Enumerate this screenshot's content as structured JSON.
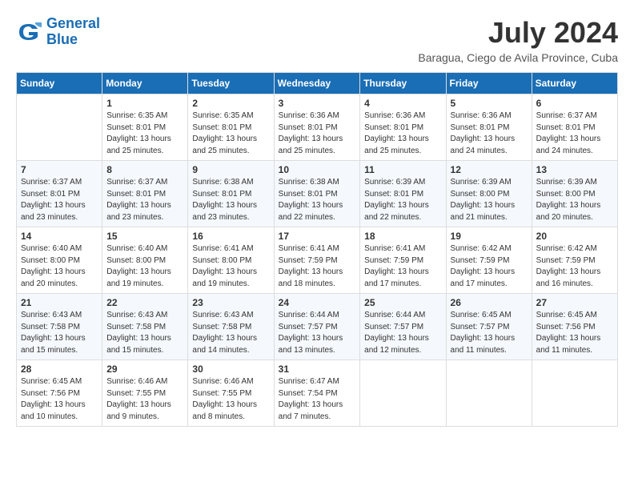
{
  "logo": {
    "line1": "General",
    "line2": "Blue"
  },
  "title": "July 2024",
  "location": "Baragua, Ciego de Avila Province, Cuba",
  "days_of_week": [
    "Sunday",
    "Monday",
    "Tuesday",
    "Wednesday",
    "Thursday",
    "Friday",
    "Saturday"
  ],
  "weeks": [
    [
      null,
      {
        "day": 1,
        "sunrise": "6:35 AM",
        "sunset": "8:01 PM",
        "daylight": "13 hours and 25 minutes."
      },
      {
        "day": 2,
        "sunrise": "6:35 AM",
        "sunset": "8:01 PM",
        "daylight": "13 hours and 25 minutes."
      },
      {
        "day": 3,
        "sunrise": "6:36 AM",
        "sunset": "8:01 PM",
        "daylight": "13 hours and 25 minutes."
      },
      {
        "day": 4,
        "sunrise": "6:36 AM",
        "sunset": "8:01 PM",
        "daylight": "13 hours and 25 minutes."
      },
      {
        "day": 5,
        "sunrise": "6:36 AM",
        "sunset": "8:01 PM",
        "daylight": "13 hours and 24 minutes."
      },
      {
        "day": 6,
        "sunrise": "6:37 AM",
        "sunset": "8:01 PM",
        "daylight": "13 hours and 24 minutes."
      }
    ],
    [
      {
        "day": 7,
        "sunrise": "6:37 AM",
        "sunset": "8:01 PM",
        "daylight": "13 hours and 23 minutes."
      },
      {
        "day": 8,
        "sunrise": "6:37 AM",
        "sunset": "8:01 PM",
        "daylight": "13 hours and 23 minutes."
      },
      {
        "day": 9,
        "sunrise": "6:38 AM",
        "sunset": "8:01 PM",
        "daylight": "13 hours and 23 minutes."
      },
      {
        "day": 10,
        "sunrise": "6:38 AM",
        "sunset": "8:01 PM",
        "daylight": "13 hours and 22 minutes."
      },
      {
        "day": 11,
        "sunrise": "6:39 AM",
        "sunset": "8:01 PM",
        "daylight": "13 hours and 22 minutes."
      },
      {
        "day": 12,
        "sunrise": "6:39 AM",
        "sunset": "8:00 PM",
        "daylight": "13 hours and 21 minutes."
      },
      {
        "day": 13,
        "sunrise": "6:39 AM",
        "sunset": "8:00 PM",
        "daylight": "13 hours and 20 minutes."
      }
    ],
    [
      {
        "day": 14,
        "sunrise": "6:40 AM",
        "sunset": "8:00 PM",
        "daylight": "13 hours and 20 minutes."
      },
      {
        "day": 15,
        "sunrise": "6:40 AM",
        "sunset": "8:00 PM",
        "daylight": "13 hours and 19 minutes."
      },
      {
        "day": 16,
        "sunrise": "6:41 AM",
        "sunset": "8:00 PM",
        "daylight": "13 hours and 19 minutes."
      },
      {
        "day": 17,
        "sunrise": "6:41 AM",
        "sunset": "7:59 PM",
        "daylight": "13 hours and 18 minutes."
      },
      {
        "day": 18,
        "sunrise": "6:41 AM",
        "sunset": "7:59 PM",
        "daylight": "13 hours and 17 minutes."
      },
      {
        "day": 19,
        "sunrise": "6:42 AM",
        "sunset": "7:59 PM",
        "daylight": "13 hours and 17 minutes."
      },
      {
        "day": 20,
        "sunrise": "6:42 AM",
        "sunset": "7:59 PM",
        "daylight": "13 hours and 16 minutes."
      }
    ],
    [
      {
        "day": 21,
        "sunrise": "6:43 AM",
        "sunset": "7:58 PM",
        "daylight": "13 hours and 15 minutes."
      },
      {
        "day": 22,
        "sunrise": "6:43 AM",
        "sunset": "7:58 PM",
        "daylight": "13 hours and 15 minutes."
      },
      {
        "day": 23,
        "sunrise": "6:43 AM",
        "sunset": "7:58 PM",
        "daylight": "13 hours and 14 minutes."
      },
      {
        "day": 24,
        "sunrise": "6:44 AM",
        "sunset": "7:57 PM",
        "daylight": "13 hours and 13 minutes."
      },
      {
        "day": 25,
        "sunrise": "6:44 AM",
        "sunset": "7:57 PM",
        "daylight": "13 hours and 12 minutes."
      },
      {
        "day": 26,
        "sunrise": "6:45 AM",
        "sunset": "7:57 PM",
        "daylight": "13 hours and 11 minutes."
      },
      {
        "day": 27,
        "sunrise": "6:45 AM",
        "sunset": "7:56 PM",
        "daylight": "13 hours and 11 minutes."
      }
    ],
    [
      {
        "day": 28,
        "sunrise": "6:45 AM",
        "sunset": "7:56 PM",
        "daylight": "13 hours and 10 minutes."
      },
      {
        "day": 29,
        "sunrise": "6:46 AM",
        "sunset": "7:55 PM",
        "daylight": "13 hours and 9 minutes."
      },
      {
        "day": 30,
        "sunrise": "6:46 AM",
        "sunset": "7:55 PM",
        "daylight": "13 hours and 8 minutes."
      },
      {
        "day": 31,
        "sunrise": "6:47 AM",
        "sunset": "7:54 PM",
        "daylight": "13 hours and 7 minutes."
      },
      null,
      null,
      null
    ]
  ]
}
